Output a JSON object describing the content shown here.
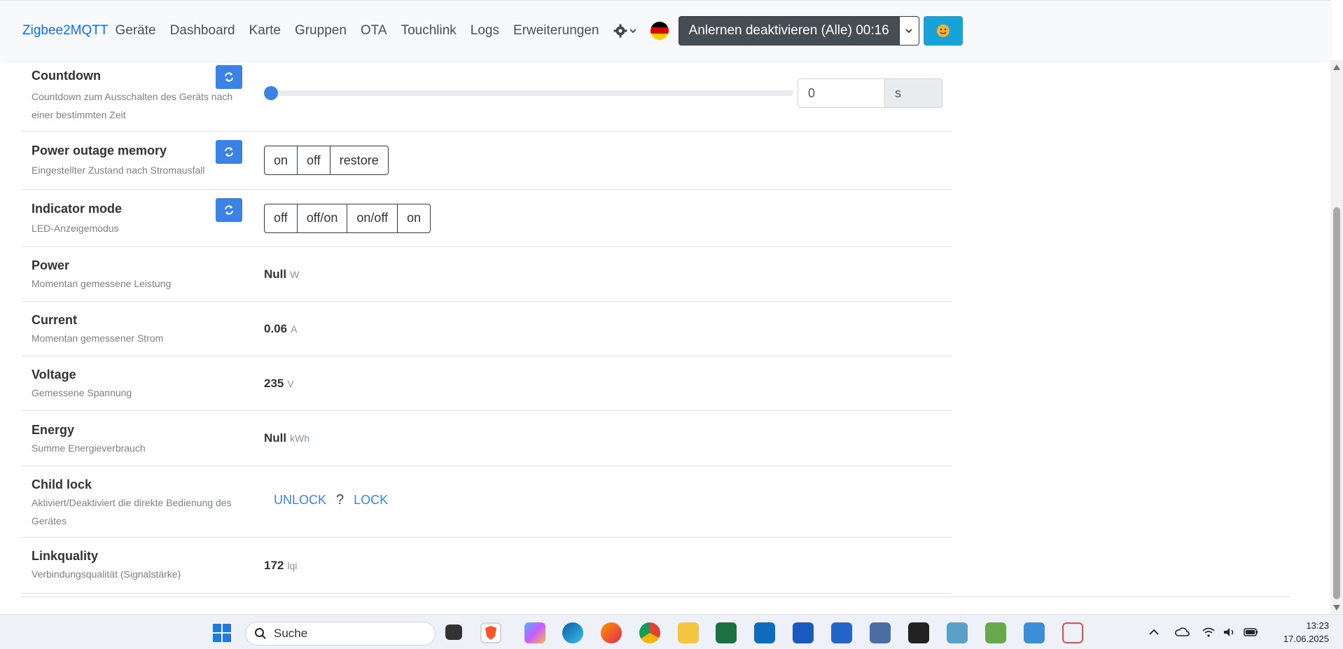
{
  "navbar": {
    "brand": "Zigbee2MQTT",
    "links": [
      "Geräte",
      "Dashboard",
      "Karte",
      "Gruppen",
      "OTA",
      "Touchlink",
      "Logs",
      "Erweiterungen"
    ],
    "permit_join_label": "Anlernen deaktivieren (Alle) 00:16",
    "user_icon": "emoji-face-icon"
  },
  "rows": {
    "countdown": {
      "title": "Countdown",
      "desc": "Countdown zum Ausschalten des Geräts nach einer bestimmten Zeit",
      "value": "0",
      "unit": "s",
      "slider_fraction": 0
    },
    "power_outage_memory": {
      "title": "Power outage memory",
      "desc": "Eingestellter Zustand nach Stromausfall",
      "options": [
        "on",
        "off",
        "restore"
      ]
    },
    "indicator_mode": {
      "title": "Indicator mode",
      "desc": "LED-Anzeigemodus",
      "options": [
        "off",
        "off/on",
        "on/off",
        "on"
      ]
    },
    "power": {
      "title": "Power",
      "desc": "Momentan gemessene Leistung",
      "value": "Null",
      "unit": "W"
    },
    "current": {
      "title": "Current",
      "desc": "Momentan gemessener Strom",
      "value": "0.06",
      "unit": "A"
    },
    "voltage": {
      "title": "Voltage",
      "desc": "Gemessene Spannung",
      "value": "235",
      "unit": "V"
    },
    "energy": {
      "title": "Energy",
      "desc": "Summe Energieverbrauch",
      "value": "Null",
      "unit": "kWh"
    },
    "child_lock": {
      "title": "Child lock",
      "desc": "Aktiviert/Deaktiviert die direkte Bedienung des Gerätes",
      "unlock": "UNLOCK",
      "state": "?",
      "lock": "LOCK"
    },
    "linkquality": {
      "title": "Linkquality",
      "desc": "Verbindungsqualität (Signalstärke)",
      "value": "172",
      "unit": "lqi"
    }
  },
  "taskbar": {
    "search_placeholder": "Suche",
    "time": "13:23",
    "date": "17.06.2025"
  },
  "colors": {
    "accent": "#3b82e6",
    "brand": "#0d6efd",
    "permit_button": "#454d55",
    "user_button": "#17a2d8"
  }
}
